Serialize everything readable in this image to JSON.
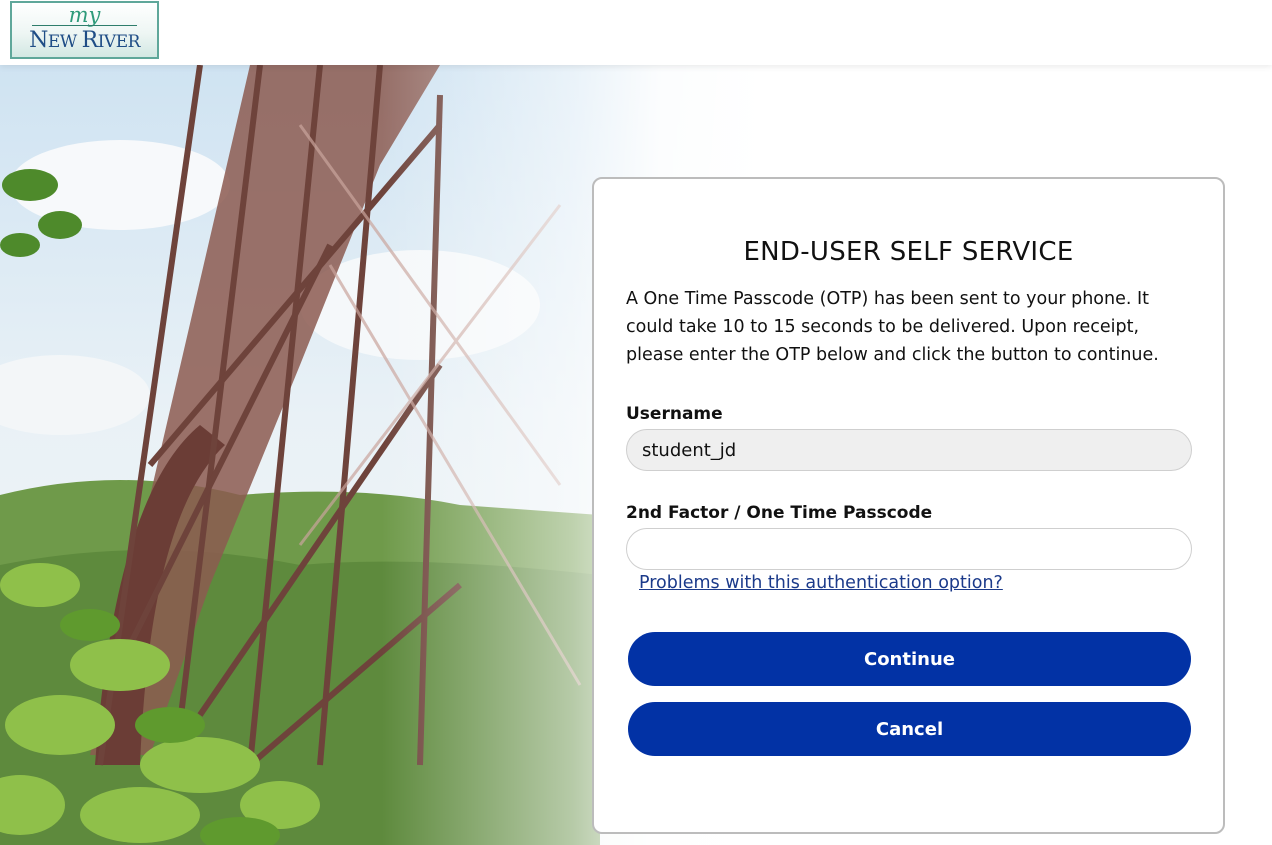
{
  "logo": {
    "top": "my",
    "main_first": "N",
    "main_first_rest": "EW ",
    "main_second": "R",
    "main_second_rest": "IVER"
  },
  "form": {
    "title": "END-USER SELF SERVICE",
    "description": "A One Time Passcode (OTP) has been sent to your phone. It could take 10 to 15 seconds to be delivered. Upon receipt, please enter the OTP below and click the button to continue.",
    "username_label": "Username",
    "username_value": "student_jd",
    "otp_label": "2nd Factor / One Time Passcode",
    "otp_value": "",
    "problems_link": "Problems with this authentication option?",
    "continue_label": "Continue",
    "cancel_label": "Cancel"
  },
  "colors": {
    "primary_button": "#0232a5",
    "link": "#1b3a8a",
    "logo_border": "#5fa79a",
    "logo_text": "#1f4d86",
    "bridge": "#7a4a42"
  }
}
